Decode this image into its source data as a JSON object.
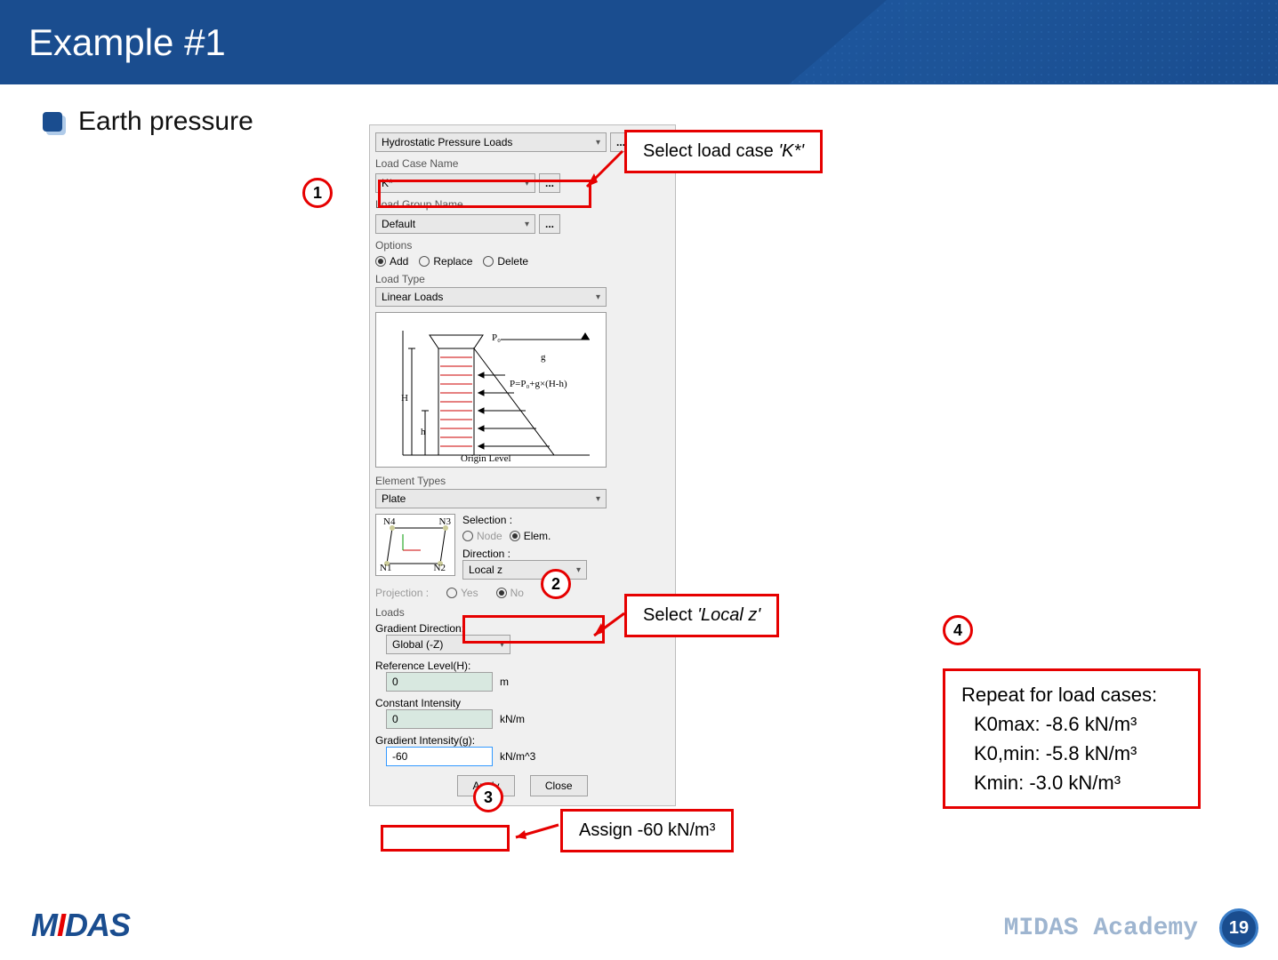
{
  "header": {
    "title": "Example #1"
  },
  "bullet": {
    "text": "Earth pressure"
  },
  "panel": {
    "main_dropdown": "Hydrostatic Pressure Loads",
    "load_case_label": "Load Case Name",
    "load_case_value": "K*",
    "load_group_label": "Load Group Name",
    "load_group_value": "Default",
    "options_label": "Options",
    "opt_add": "Add",
    "opt_replace": "Replace",
    "opt_delete": "Delete",
    "load_type_label": "Load Type",
    "load_type_value": "Linear Loads",
    "diagram": {
      "H": "H",
      "h": "h",
      "P0": "P₀",
      "g": "g",
      "formula": "P=P₀+g×(H-h)",
      "origin": "Origin Level"
    },
    "elem_types_label": "Element Types",
    "elem_types_value": "Plate",
    "selection_label": "Selection :",
    "sel_node": "Node",
    "sel_elem": "Elem.",
    "direction_label": "Direction :",
    "direction_value": "Local z",
    "projection_label": "Projection :",
    "proj_yes": "Yes",
    "proj_no": "No",
    "loads_label": "Loads",
    "grad_dir_label": "Gradient Direction:",
    "grad_dir_value": "Global (-Z)",
    "ref_level_label": "Reference Level(H):",
    "ref_level_value": "0",
    "ref_level_unit": "m",
    "const_int_label": "Constant Intensity",
    "const_int_value": "0",
    "const_int_unit": "kN/m",
    "grad_int_label": "Gradient Intensity(g):",
    "grad_int_value": "-60",
    "grad_int_unit": "kN/m^3",
    "apply": "Apply",
    "close": "Close",
    "elem_diag": {
      "n1": "N1",
      "n2": "N2",
      "n3": "N3",
      "n4": "N4"
    }
  },
  "callouts": {
    "c1": {
      "num": "1",
      "text_pre": "Select load case ",
      "text_em": "'K*'"
    },
    "c2": {
      "num": "2",
      "text_pre": "Select ",
      "text_em": "'Local z'"
    },
    "c3": {
      "num": "3",
      "text": "Assign -60 kN/m³"
    },
    "c4": {
      "num": "4",
      "title": "Repeat for load cases:",
      "l1": "K0max: -8.6 kN/m³",
      "l2": "K0,min: -5.8 kN/m³",
      "l3": "Kmin: -3.0 kN/m³"
    }
  },
  "footer": {
    "logo_m": "M",
    "logo_i": "I",
    "logo_rest": "DAS",
    "academy": "MIDAS Academy",
    "page": "19"
  }
}
